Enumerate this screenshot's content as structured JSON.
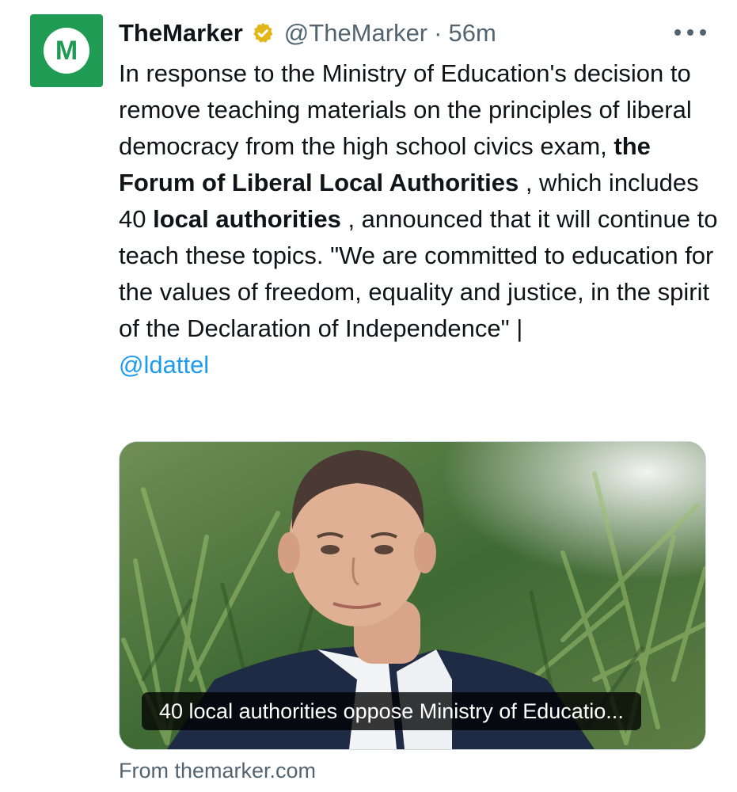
{
  "author": {
    "avatar_letter": "M",
    "display_name": "TheMarker",
    "handle": "@TheMarker",
    "separator": "·",
    "time": "56m"
  },
  "tweet": {
    "text_1": "In response to the Ministry of Education's decision to remove teaching materials on the principles of liberal democracy from the high school civics exam, ",
    "bold_1": "the Forum of Liberal Local Authorities",
    "text_2": " , which includes 40 ",
    "bold_2": "local authorities",
    "text_3": " , announced that it will continue to teach these topics. \"We are committed to education for the values of freedom, equality and justice, in the spirit of the Declaration of Independence\" |",
    "mention": "@ldattel"
  },
  "card": {
    "caption": "40 local authorities oppose Ministry of Educatio...",
    "source": "From themarker.com"
  },
  "colors": {
    "brand_green": "#1f9b54",
    "verified_gold": "#e2b719",
    "link_blue": "#1d9bf0",
    "secondary_text": "#536471"
  },
  "icons": {
    "verified": "verified-badge-icon",
    "more": "more-options-icon"
  }
}
